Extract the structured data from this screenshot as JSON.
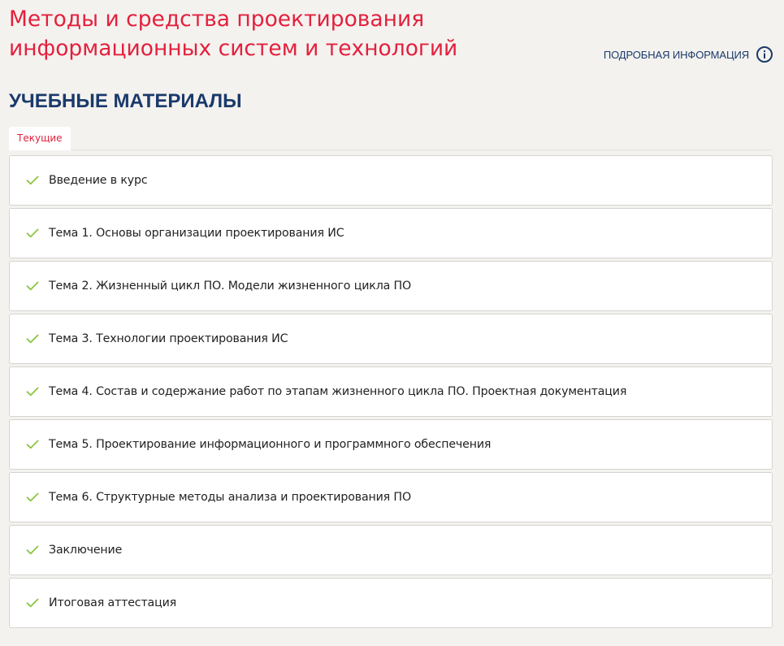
{
  "course": {
    "title": "Методы и средства проектирования информационных систем и технологий"
  },
  "info_link": {
    "label": "ПОДРОБНАЯ ИНФОРМАЦИЯ",
    "icon": "info-circle-icon"
  },
  "section": {
    "heading": "УЧЕБНЫЕ МАТЕРИАЛЫ"
  },
  "tabs": [
    {
      "label": "Текущие",
      "active": true
    }
  ],
  "materials": [
    {
      "label": "Введение в курс",
      "completed": true,
      "icon": "check-icon"
    },
    {
      "label": "Тема 1. Основы организации проектирования ИС",
      "completed": true,
      "icon": "check-icon"
    },
    {
      "label": "Тема 2. Жизненный цикл ПО. Модели жизненного цикла ПО",
      "completed": true,
      "icon": "check-icon"
    },
    {
      "label": "Тема 3. Технологии проектирования ИС",
      "completed": true,
      "icon": "check-icon"
    },
    {
      "label": "Тема 4. Состав и содержание работ по этапам жизненного цикла ПО. Проектная документация",
      "completed": true,
      "icon": "check-icon"
    },
    {
      "label": "Тема 5. Проектирование информационного и программного обеспечения",
      "completed": true,
      "icon": "check-icon"
    },
    {
      "label": "Тема 6. Структурные методы анализа и проектирования ПО",
      "completed": true,
      "icon": "check-icon"
    },
    {
      "label": "Заключение",
      "completed": true,
      "icon": "check-icon"
    },
    {
      "label": "Итоговая аттестация",
      "completed": true,
      "icon": "check-icon"
    }
  ],
  "colors": {
    "title": "#e3203d",
    "heading": "#1a3a6b",
    "check": "#8cc63f",
    "background": "#f4f2ef"
  }
}
